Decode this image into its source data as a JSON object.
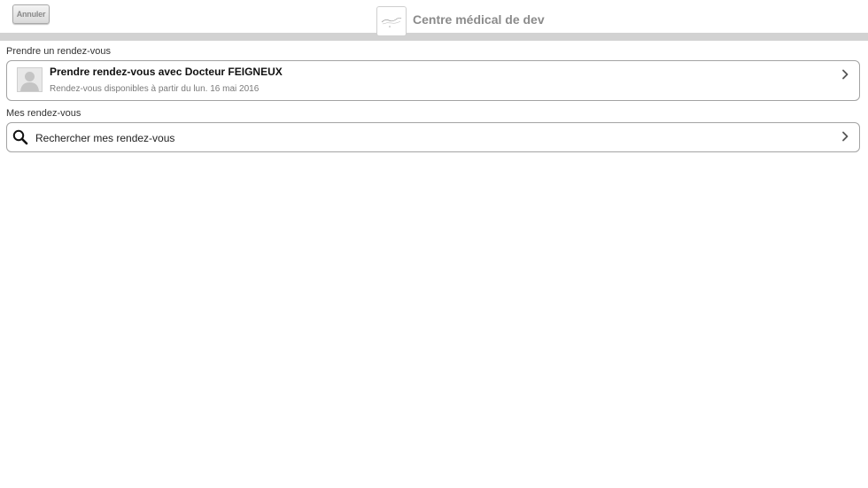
{
  "header": {
    "cancel_label": "Annuler",
    "title": "Centre médical de dev",
    "logo_icon": "clinic-logo-icon"
  },
  "book_section": {
    "label": "Prendre un rendez-vous",
    "item": {
      "title": "Prendre rendez-vous avec Docteur FEIGNEUX",
      "subtitle": "Rendez-vous disponibles à partir du lun. 16 mai 2016",
      "avatar_icon": "user-avatar-icon",
      "chevron_icon": "chevron-right-icon"
    }
  },
  "my_section": {
    "label": "Mes rendez-vous",
    "item": {
      "label": "Rechercher mes rendez-vous",
      "icon": "search-icon",
      "chevron_icon": "chevron-right-icon"
    }
  },
  "colors": {
    "header_bar": "#d2d2d2",
    "card_border": "#a3a3a3",
    "title_gray": "#8b8b8b"
  }
}
